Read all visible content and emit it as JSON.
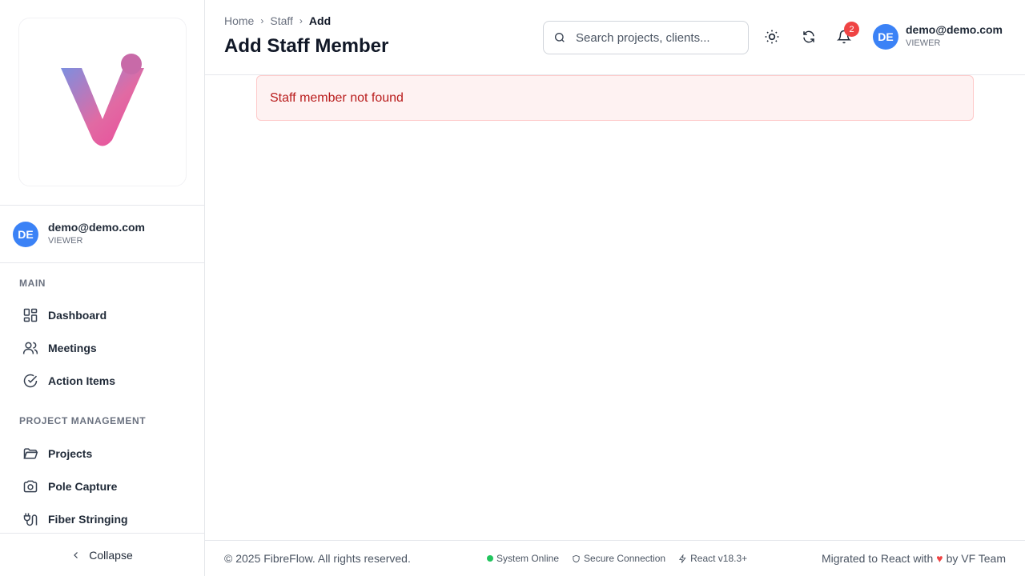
{
  "sidebar": {
    "user": {
      "initials": "DE",
      "email": "demo@demo.com",
      "role": "VIEWER"
    },
    "sections": [
      {
        "label": "MAIN",
        "items": [
          {
            "label": "Dashboard",
            "icon": "dashboard-icon"
          },
          {
            "label": "Meetings",
            "icon": "users-icon"
          },
          {
            "label": "Action Items",
            "icon": "check-circle-icon"
          }
        ]
      },
      {
        "label": "PROJECT MANAGEMENT",
        "items": [
          {
            "label": "Projects",
            "icon": "folder-icon"
          },
          {
            "label": "Pole Capture",
            "icon": "camera-icon"
          },
          {
            "label": "Fiber Stringing",
            "icon": "plug-icon"
          }
        ]
      }
    ],
    "collapse_label": "Collapse"
  },
  "header": {
    "breadcrumb": [
      "Home",
      "Staff",
      "Add"
    ],
    "title": "Add Staff Member",
    "search_placeholder": "Search projects, clients...",
    "notification_count": "2",
    "user": {
      "initials": "DE",
      "email": "demo@demo.com",
      "role": "VIEWER"
    }
  },
  "main": {
    "alert": "Staff member not found"
  },
  "footer": {
    "copyright": "© 2025 FibreFlow. All rights reserved.",
    "status": [
      "System Online",
      "Secure Connection",
      "React v18.3+"
    ],
    "migrated_prefix": "Migrated to React with",
    "migrated_suffix": "by VF Team"
  },
  "colors": {
    "accent": "#3b82f6",
    "alert_bg": "#fef2f2",
    "alert_text": "#b91c1c",
    "badge": "#ef4444",
    "online": "#22c55e"
  }
}
